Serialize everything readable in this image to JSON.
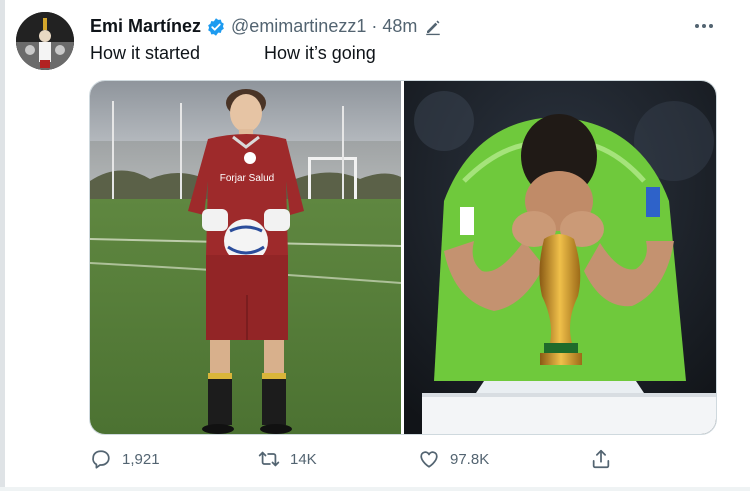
{
  "tweet": {
    "display_name": "Emi Martínez",
    "handle": "@emimartinezz1",
    "separator": "·",
    "time": "48m",
    "caption_left": "How it started",
    "caption_right": "How it’s going",
    "verified_color": "#1d9bf0"
  },
  "media": {
    "left_photo": "goalkeeper-youth-kit-photo",
    "right_photo": "world-cup-trophy-photo",
    "left_jersey_text": "Forjar Salud"
  },
  "actions": {
    "replies": "1,921",
    "retweets": "14K",
    "likes": "97.8K"
  },
  "icons": {
    "reply": "reply-icon",
    "retweet": "retweet-icon",
    "like": "heart-icon",
    "share": "share-icon",
    "more": "more-icon",
    "edited": "edit-icon",
    "verified": "verified-badge-icon"
  }
}
